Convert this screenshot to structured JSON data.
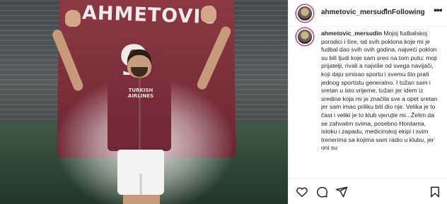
{
  "media": {
    "banner_name": "AHMETOVIĆ",
    "banner_number": "9",
    "sponsor_line1": "TURKISH",
    "sponsor_line2": "AIRLINES"
  },
  "post": {
    "username": "ahmetovic_mersudin",
    "separator": "•",
    "follow_status": "Following",
    "more_icon": "more-horizontal-icon"
  },
  "caption": {
    "username": "ahmetovic_mersudin",
    "text": "Mojoj fudbalskoj porodici i šire, od svih poklona koje mi je fudbal dao svih ovih godina, najveći poklon su bili ljudi koje sam sreo na tom putu: moji prijatelji, rivali a najviše od svega navijači, koji daju smisao sportu i svemu što prati jednog sportistu generalno. I tužan sam i sretan u isto vrijeme, tužan jer idem iz sredine koja mi je značila sve a opet sretan jer sam imao priliku biti dio nje. Velika je to čast i veliki je to klub vjerujte mi...Želim da se zahvalim svima, posebno Hordama, istoku i zapadu, medicinskoj ekipi i svim trenerima sa kojima sam radio u klubu, jer oni su"
  },
  "actions": {
    "like_icon": "heart-icon",
    "comment_icon": "comment-icon",
    "share_icon": "share-icon",
    "save_icon": "bookmark-icon"
  }
}
